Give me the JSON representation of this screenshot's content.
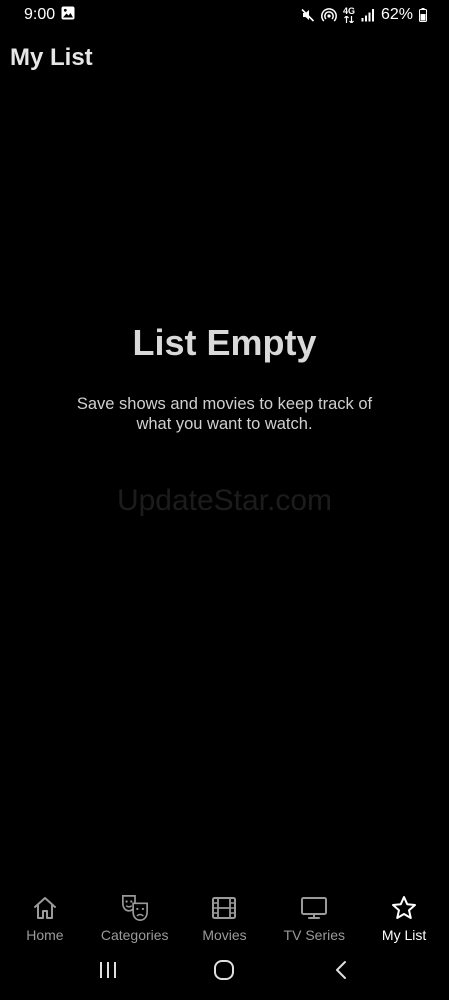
{
  "status_bar": {
    "time": "9:00",
    "network_label": "4G",
    "battery": "62%",
    "icons": [
      "gallery-icon",
      "mute-icon",
      "hotspot-icon",
      "network-icon",
      "signal-icon",
      "battery-icon"
    ]
  },
  "header": {
    "title": "My List"
  },
  "empty_state": {
    "title": "List Empty",
    "message": "Save shows and movies to keep track of what you want to watch."
  },
  "watermark": {
    "text": "UpdateStar.com"
  },
  "bottom_nav": {
    "items": [
      {
        "label": "Home",
        "icon": "home-icon"
      },
      {
        "label": "Categories",
        "icon": "theater-masks-icon"
      },
      {
        "label": "Movies",
        "icon": "film-icon"
      },
      {
        "label": "TV Series",
        "icon": "tv-icon"
      },
      {
        "label": "My List",
        "icon": "star-icon"
      }
    ],
    "active": "My List",
    "active_color": "#ffffff",
    "inactive_color": "#9a9a9a"
  },
  "system_nav": {
    "buttons": [
      "recents-icon",
      "home-circle-icon",
      "back-icon"
    ]
  }
}
